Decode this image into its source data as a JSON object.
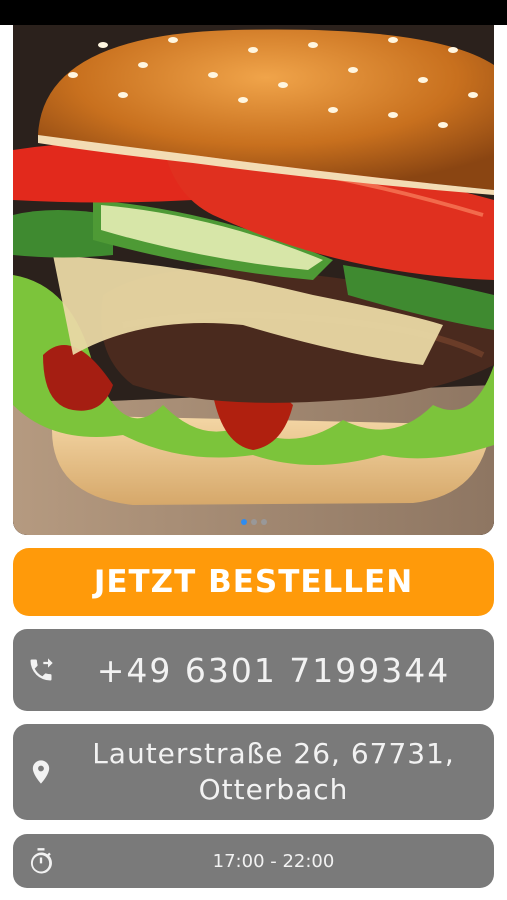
{
  "hero": {
    "image_alt": "burger-photo",
    "carousel_count": 3,
    "carousel_active": 0
  },
  "order_button": {
    "label": "JETZT BESTELLEN"
  },
  "contact": {
    "phone": {
      "value": "+49 6301 7199344",
      "icon": "phone-forward-icon"
    },
    "address": {
      "line1": "Lauterstraße 26, 67731,",
      "line2": "Otterbach",
      "icon": "location-pin-icon"
    },
    "hours": {
      "value": "17:00 - 22:00",
      "icon": "stopwatch-icon"
    }
  },
  "colors": {
    "accent": "#ff9a0a",
    "card": "#7a7a7a",
    "dot_active": "#2f8cf0"
  }
}
